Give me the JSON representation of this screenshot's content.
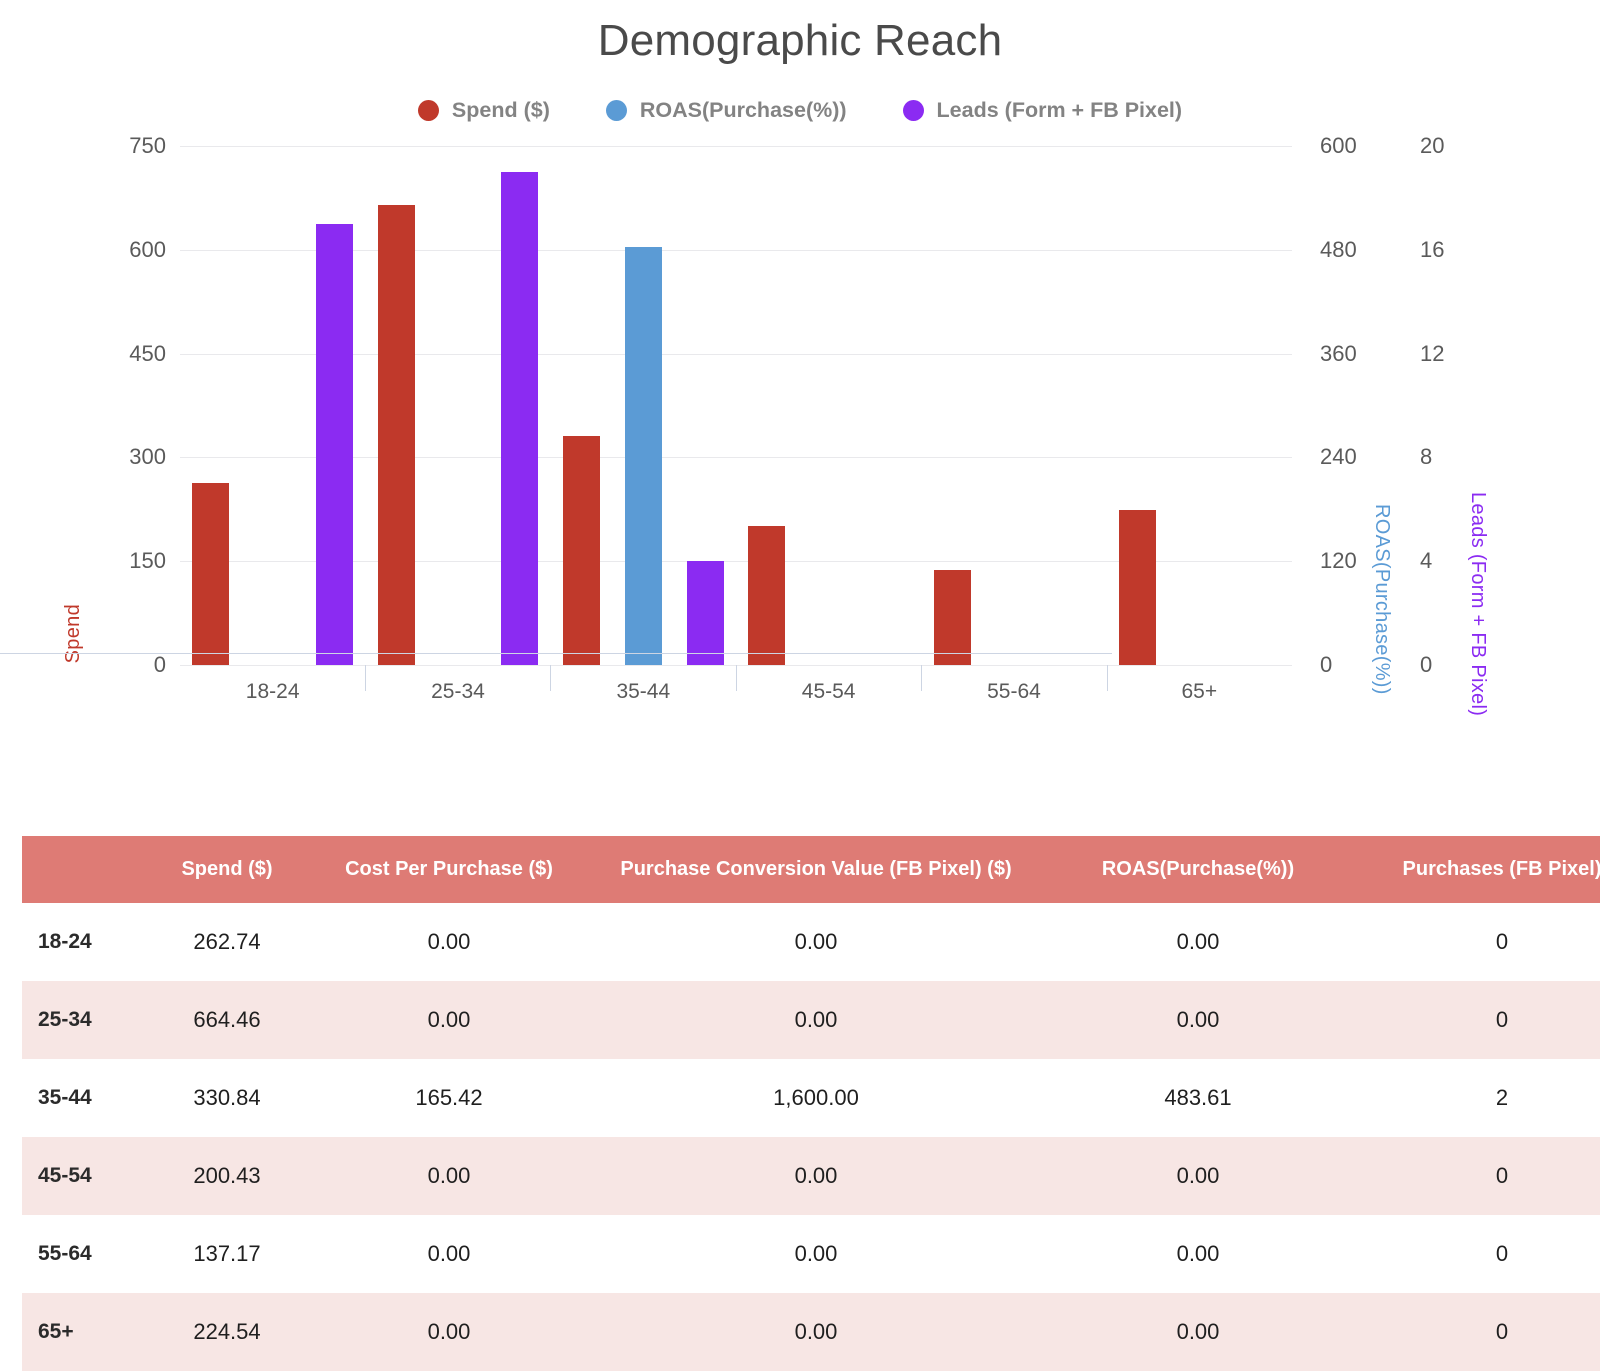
{
  "title": "Demographic Reach",
  "colors": {
    "spend": "#c0392b",
    "roas": "#5b9bd5",
    "leads": "#8b2bf2",
    "table_header_bg": "#de7b75",
    "table_alt_row_bg": "#f7e6e4"
  },
  "legend": {
    "items": [
      {
        "label": "Spend ($)",
        "color": "#c0392b",
        "marker": "circle-marker"
      },
      {
        "label": "ROAS(Purchase(%))",
        "color": "#5b9bd5",
        "marker": "circle-marker"
      },
      {
        "label": "Leads (Form + FB Pixel)",
        "color": "#8b2bf2",
        "marker": "circle-marker"
      }
    ]
  },
  "axes": {
    "left": {
      "title": "Spend",
      "ticks": [
        "750",
        "600",
        "450",
        "300",
        "150",
        "0"
      ],
      "min": 0,
      "max": 750
    },
    "right1": {
      "title": "ROAS(Purchase(%))",
      "ticks": [
        "600",
        "480",
        "360",
        "240",
        "120",
        "0"
      ],
      "min": 0,
      "max": 600
    },
    "right2": {
      "title": "Leads (Form + FB Pixel)",
      "ticks": [
        "20",
        "16",
        "12",
        "8",
        "4",
        "0"
      ],
      "min": 0,
      "max": 20
    },
    "x": {
      "categories": [
        "18-24",
        "25-34",
        "35-44",
        "45-54",
        "55-64",
        "65+"
      ]
    }
  },
  "chart_data": {
    "type": "bar",
    "title": "Demographic Reach",
    "xlabel": "",
    "ylabel": "Spend",
    "grid": true,
    "legend_position": "top-center",
    "categories": [
      "18-24",
      "25-34",
      "35-44",
      "45-54",
      "55-64",
      "65+"
    ],
    "series": [
      {
        "name": "Spend ($)",
        "axis": "left",
        "color": "#c0392b",
        "ylim": [
          0,
          750
        ],
        "values": [
          262.74,
          664.46,
          330.84,
          200.43,
          137.17,
          224.54
        ]
      },
      {
        "name": "ROAS(Purchase(%))",
        "axis": "right1",
        "color": "#5b9bd5",
        "ylim": [
          0,
          600
        ],
        "values": [
          0,
          0,
          483.61,
          0,
          0,
          0
        ]
      },
      {
        "name": "Leads (Form + FB Pixel)",
        "axis": "right2",
        "color": "#8b2bf2",
        "ylim": [
          0,
          20
        ],
        "values": [
          17.0,
          19.0,
          4.0,
          0,
          0,
          0
        ]
      }
    ]
  },
  "table": {
    "columns": [
      "",
      "Spend ($)",
      "Cost Per Purchase ($)",
      "Purchase Conversion Value (FB Pixel) ($)",
      "ROAS(Purchase(%))",
      "Purchases (FB Pixel)"
    ],
    "rows": [
      {
        "label": "18-24",
        "spend": "262.74",
        "cpp": "0.00",
        "pcv": "0.00",
        "roas": "0.00",
        "purchases": "0"
      },
      {
        "label": "25-34",
        "spend": "664.46",
        "cpp": "0.00",
        "pcv": "0.00",
        "roas": "0.00",
        "purchases": "0"
      },
      {
        "label": "35-44",
        "spend": "330.84",
        "cpp": "165.42",
        "pcv": "1,600.00",
        "roas": "483.61",
        "purchases": "2"
      },
      {
        "label": "45-54",
        "spend": "200.43",
        "cpp": "0.00",
        "pcv": "0.00",
        "roas": "0.00",
        "purchases": "0"
      },
      {
        "label": "55-64",
        "spend": "137.17",
        "cpp": "0.00",
        "pcv": "0.00",
        "roas": "0.00",
        "purchases": "0"
      },
      {
        "label": "65+",
        "spend": "224.54",
        "cpp": "0.00",
        "pcv": "0.00",
        "roas": "0.00",
        "purchases": "0"
      }
    ]
  }
}
